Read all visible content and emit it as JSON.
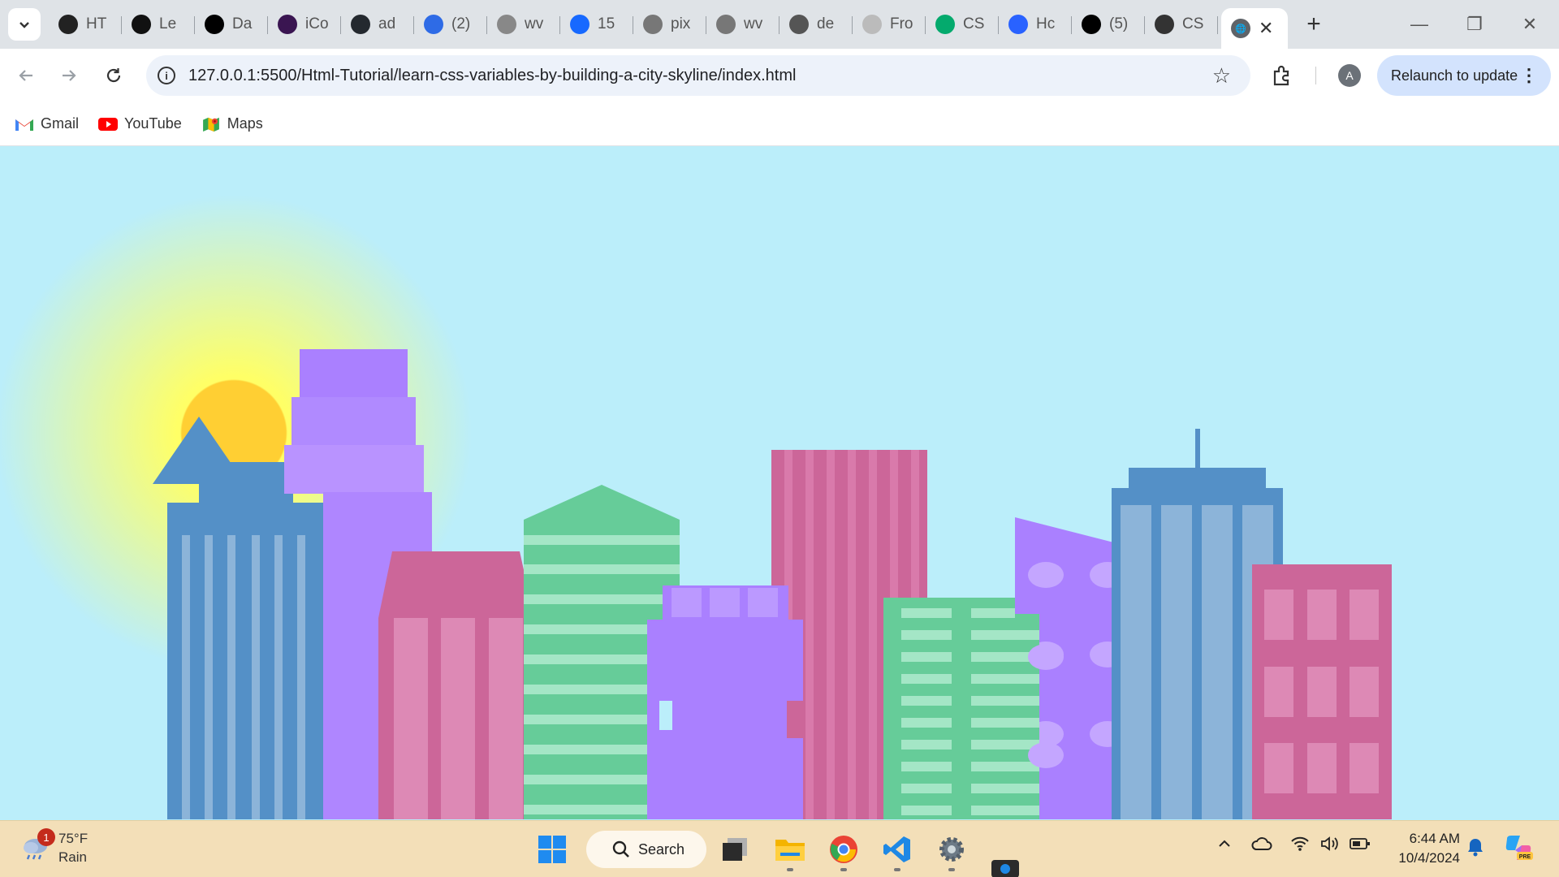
{
  "browser": {
    "tabs": [
      {
        "label": "HT",
        "icon": "openai-icon",
        "color": "#222222"
      },
      {
        "label": "Le",
        "icon": "lambda-icon",
        "color": "#111111"
      },
      {
        "label": "Da",
        "icon": "medium-icon",
        "color": "#000000"
      },
      {
        "label": "iCo",
        "icon": "icodethis-icon",
        "color": "#3a1551"
      },
      {
        "label": "ad",
        "icon": "github-icon",
        "color": "#24292f"
      },
      {
        "label": "(2)",
        "icon": "copilot-notification-icon",
        "color": "#2e6be6"
      },
      {
        "label": "wv",
        "icon": "wave-icon",
        "color": "#888888"
      },
      {
        "label": "15",
        "icon": "profile-icon",
        "color": "#1769ff"
      },
      {
        "label": "pix",
        "icon": "pixabay-icon",
        "color": "#777777"
      },
      {
        "label": "wv",
        "icon": "linkedin-icon",
        "color": "#777777"
      },
      {
        "label": "de",
        "icon": "dev-icon",
        "color": "#555555"
      },
      {
        "label": "Fro",
        "icon": "frontend-icon",
        "color": "#bbbbbb"
      },
      {
        "label": "CS",
        "icon": "w3schools-icon",
        "color": "#04aa6d"
      },
      {
        "label": "Hc",
        "icon": "hashnode-icon",
        "color": "#2962ff"
      },
      {
        "label": "(5)",
        "icon": "x-icon",
        "color": "#000000"
      },
      {
        "label": "CS",
        "icon": "codepen-icon",
        "color": "#333333"
      }
    ],
    "active_tab": {
      "icon": "globe-icon",
      "close": "✕"
    },
    "new_tab": "+",
    "window_controls": {
      "minimize": "—",
      "restore": "❐",
      "close": "✕"
    },
    "url": "127.0.0.1:5500/Html-Tutorial/learn-css-variables-by-building-a-city-skyline/index.html",
    "profile_initial": "A",
    "relaunch_label": "Relaunch to update",
    "bookmarks": [
      {
        "label": "Gmail",
        "icon": "gmail-icon"
      },
      {
        "label": "YouTube",
        "icon": "youtube-icon"
      },
      {
        "label": "Maps",
        "icon": "maps-icon"
      }
    ]
  },
  "skyline": {
    "colors": {
      "sky": "#bbeefa",
      "sun": "#ffcf33",
      "sun_glow": "#ffff66",
      "blue": "#5490c7",
      "blue_window": "#8cb4d9",
      "purple": "#aa80ff",
      "purple_light": "#b993ff",
      "pink": "#cc6699",
      "pink_window": "#dd89b5",
      "green": "#66cc99",
      "green_window": "#a4e6c6"
    }
  },
  "taskbar": {
    "weather": {
      "temp": "75°F",
      "condition": "Rain",
      "badge": "1"
    },
    "search_label": "Search",
    "clock": {
      "time": "6:44 AM",
      "date": "10/4/2024"
    }
  }
}
